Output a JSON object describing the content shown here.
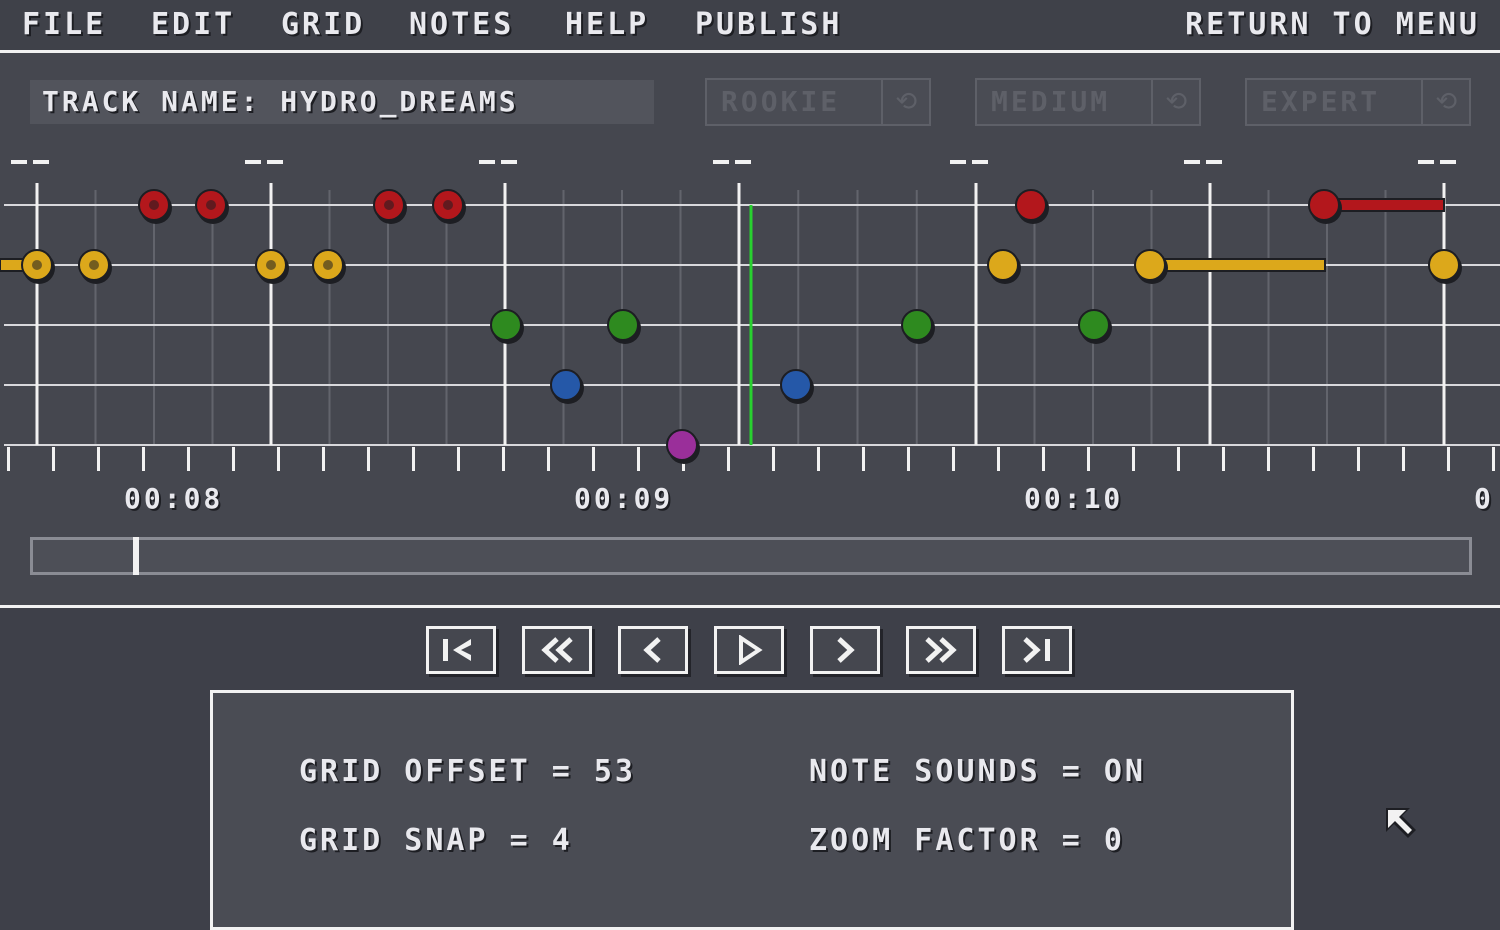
{
  "menu": {
    "items": [
      "FILE",
      "EDIT",
      "GRID",
      "NOTES",
      "HELP",
      "PUBLISH"
    ],
    "return_label": "RETURN TO MENU"
  },
  "track": {
    "name_label": "TRACK NAME: HYDRO_DREAMS"
  },
  "difficulty": {
    "options": [
      {
        "label": "ROOKIE",
        "active": false
      },
      {
        "label": "MEDIUM",
        "active": false
      },
      {
        "label": "EXPERT",
        "active": true
      }
    ],
    "icon": "restore-icon"
  },
  "timeline": {
    "tick_labels": [
      "00:08",
      "00:09",
      "00:10",
      "0"
    ],
    "playhead_color": "#28d12f",
    "lane_colors": [
      "#b3171c",
      "#dca81b",
      "#2e8a1f",
      "#2558a8",
      "#9a2f9a"
    ]
  },
  "transport": {
    "buttons": [
      {
        "name": "skip-to-start-button",
        "icon": "skip-start-icon"
      },
      {
        "name": "fast-rewind-button",
        "icon": "fast-rewind-icon"
      },
      {
        "name": "step-back-button",
        "icon": "step-back-icon"
      },
      {
        "name": "play-button",
        "icon": "play-icon"
      },
      {
        "name": "step-forward-button",
        "icon": "step-forward-icon"
      },
      {
        "name": "fast-forward-button",
        "icon": "fast-forward-icon"
      },
      {
        "name": "skip-to-end-button",
        "icon": "skip-end-icon"
      }
    ]
  },
  "settings": {
    "grid_offset": "GRID OFFSET = 53",
    "grid_snap": "GRID SNAP = 4",
    "note_sounds": "NOTE SOUNDS = ON",
    "zoom_factor": "ZOOM FACTOR = 0"
  }
}
